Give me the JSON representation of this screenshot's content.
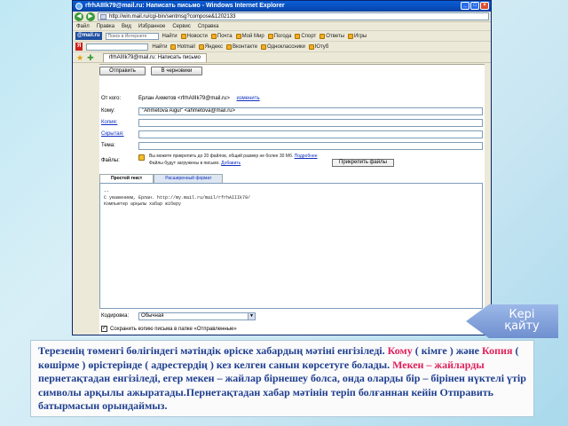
{
  "window": {
    "title": "rfrhAIIIk79@mail.ru: Написать письмо - Windows Internet Explorer",
    "address": "http://win.mail.ru/cgi-bin/sentmsg?compose&1202133",
    "menu": [
      "Файл",
      "Правка",
      "Вид",
      "Избранное",
      "Сервис",
      "Справка"
    ],
    "toolbar": {
      "logo": "@mail.ru",
      "search_placeholder": "Поиск в Интернете",
      "search_label": "Найти",
      "items": [
        "Новости",
        "Почта",
        "Мой Мир",
        "Погода",
        "Спорт",
        "Ответы",
        "Игры"
      ]
    },
    "toolbar2": {
      "items": [
        "Найти",
        "Hotmail",
        "Яндекс",
        "Вконтакте",
        "Одноклассники",
        "Ютуб"
      ]
    },
    "tab_title": "rfrhAIIIk79@mail.ru: Написать письмо"
  },
  "compose": {
    "send_label": "Отправить",
    "draft_label": "В черновики",
    "from_label": "От кого:",
    "from_value": "Ерлан Ахметов <rfrhAIIIk79@mail.ru>",
    "from_change": "изменить",
    "to_label": "Кому:",
    "to_value": "\"Ahmetova Aigul\" <ahmetova@mail.ru>",
    "cc_label": "Копия:",
    "bcc_label": "Скрытая:",
    "subject_label": "Тема:",
    "files_label": "Файлы:",
    "files_text": "Вы можете прикрепить до 20 файлов, общий размер не более 30 Мб.",
    "files_link": "Подробнее",
    "files_text2": "Файлы будут загружены в письмо.",
    "files_link2": "Добавить",
    "attach_button": "Прикрепить файлы",
    "tab_plain": "Простой текст",
    "tab_rich": "Расширенный формат",
    "body_lines": [
      "--",
      "С уважением, Ерлан. http://my.mail.ru/mail/rfrhAIIIk79/",
      "Компьютер арқылы хабар жіберу"
    ],
    "encoding_label": "Кодировка:",
    "encoding_value": "Обычная",
    "save_label": "Сохранить копию письма в папке «Отправленные»"
  },
  "back_button": {
    "line1": "Кері",
    "line2": "қайту"
  },
  "caption": {
    "p1": "Терезенің төменгі бөлігіндегі мәтіндік өріске хабардың мәтіні енгізіледі.",
    "kimge": "Кому",
    "p2": "( кімге ) және",
    "kopiya": "Копия",
    "p3": "( көшірме ) өрістерінде ( адрестердің ) кез келген санын көрсетуге болады.",
    "mekenter": "Мекен – жайларды",
    "p4": "пернетақтадан енгізіледі, егер мекен – жайлар бірнешеу болса, онда оларды бір – бірінен нүктелі үтір символы арқылы ажыратады.Пернетақтадан хабар мәтінін теріп болғаннан кейін Отправить батырмасын орындаймыз."
  }
}
